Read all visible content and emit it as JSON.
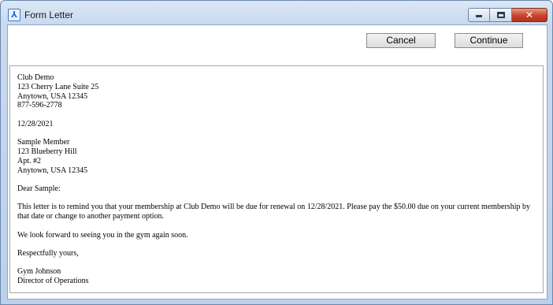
{
  "window": {
    "title": "Form Letter",
    "icon": "app-person-icon",
    "controls": {
      "minimize": "minimize",
      "maximize": "maximize",
      "close": "✕"
    }
  },
  "buttons": {
    "cancel": "Cancel",
    "continue": "Continue"
  },
  "letter": {
    "sender": [
      "Club Demo",
      "123 Cherry Lane Suite 25",
      "Anytown, USA 12345",
      "877-596-2778"
    ],
    "date": "12/28/2021",
    "recipient": [
      "Sample Member",
      "123 Blueberry Hill",
      "Apt. #2",
      "Anytown, USA 12345"
    ],
    "greeting": "Dear Sample:",
    "body1": "This letter is to remind you that your membership at Club Demo will be due for renewal on 12/28/2021. Please pay the $50.00 due on your current membership by that date or change to another payment option.",
    "body2": "We look forward to seeing you in the gym again soon.",
    "closing": "Respectfully yours,",
    "signature": [
      "Gym Johnson",
      "Director of Operations"
    ]
  }
}
